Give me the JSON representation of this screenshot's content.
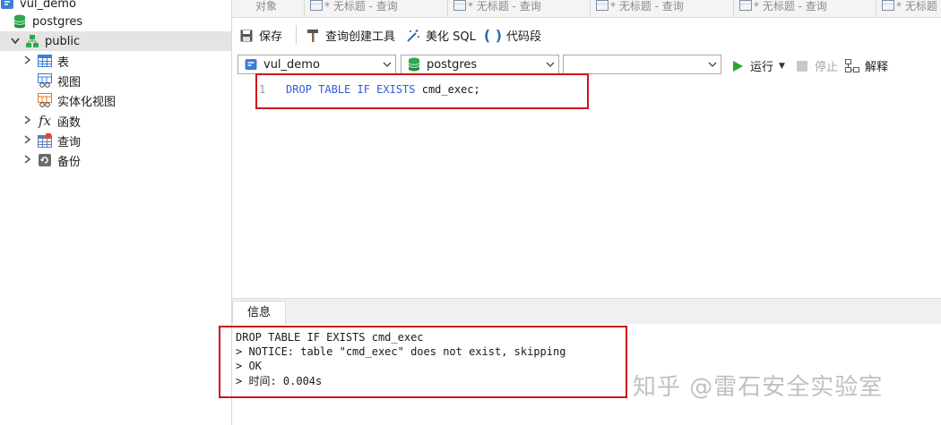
{
  "nav": {
    "items": [
      {
        "label": "vul_demo",
        "icon": "connection-icon"
      },
      {
        "label": "postgres",
        "icon": "database-icon"
      },
      {
        "label": "public",
        "icon": "schema-icon"
      },
      {
        "label": "表",
        "icon": "table-icon"
      },
      {
        "label": "视图",
        "icon": "view-icon"
      },
      {
        "label": "实体化视图",
        "icon": "materialized-view-icon"
      },
      {
        "label": "函数",
        "icon": "function-icon"
      },
      {
        "label": "查询",
        "icon": "query-icon"
      },
      {
        "label": "备份",
        "icon": "backup-icon"
      }
    ]
  },
  "tabs": [
    {
      "label": "对象"
    },
    {
      "label": "* 无标题 - 查询"
    },
    {
      "label": "* 无标题 - 查询"
    },
    {
      "label": "* 无标题 - 查询"
    },
    {
      "label": "* 无标题 - 查询"
    },
    {
      "label": "* 无标题"
    }
  ],
  "toolbar": {
    "save": "保存",
    "query_builder": "查询创建工具",
    "beautify": "美化 SQL",
    "snippet": "代码段",
    "run": "运行",
    "stop": "停止",
    "explain": "解释"
  },
  "selects": {
    "connection": "vul_demo",
    "database": "postgres",
    "schema": ""
  },
  "editor": {
    "line_number": "1",
    "kw1": "DROP TABLE IF EXISTS",
    "ident": "cmd_exec;"
  },
  "info": {
    "tab": "信息",
    "lines": [
      "DROP TABLE IF EXISTS cmd_exec",
      "> NOTICE:  table \"cmd_exec\" does not exist, skipping",
      "> OK",
      "> 时间: 0.004s"
    ]
  },
  "watermark": "知乎 @雷石安全实验室",
  "colors": {
    "keyword": "#2b5fd9",
    "highlight_box": "#d0121b",
    "run_green": "#2aa33a"
  }
}
